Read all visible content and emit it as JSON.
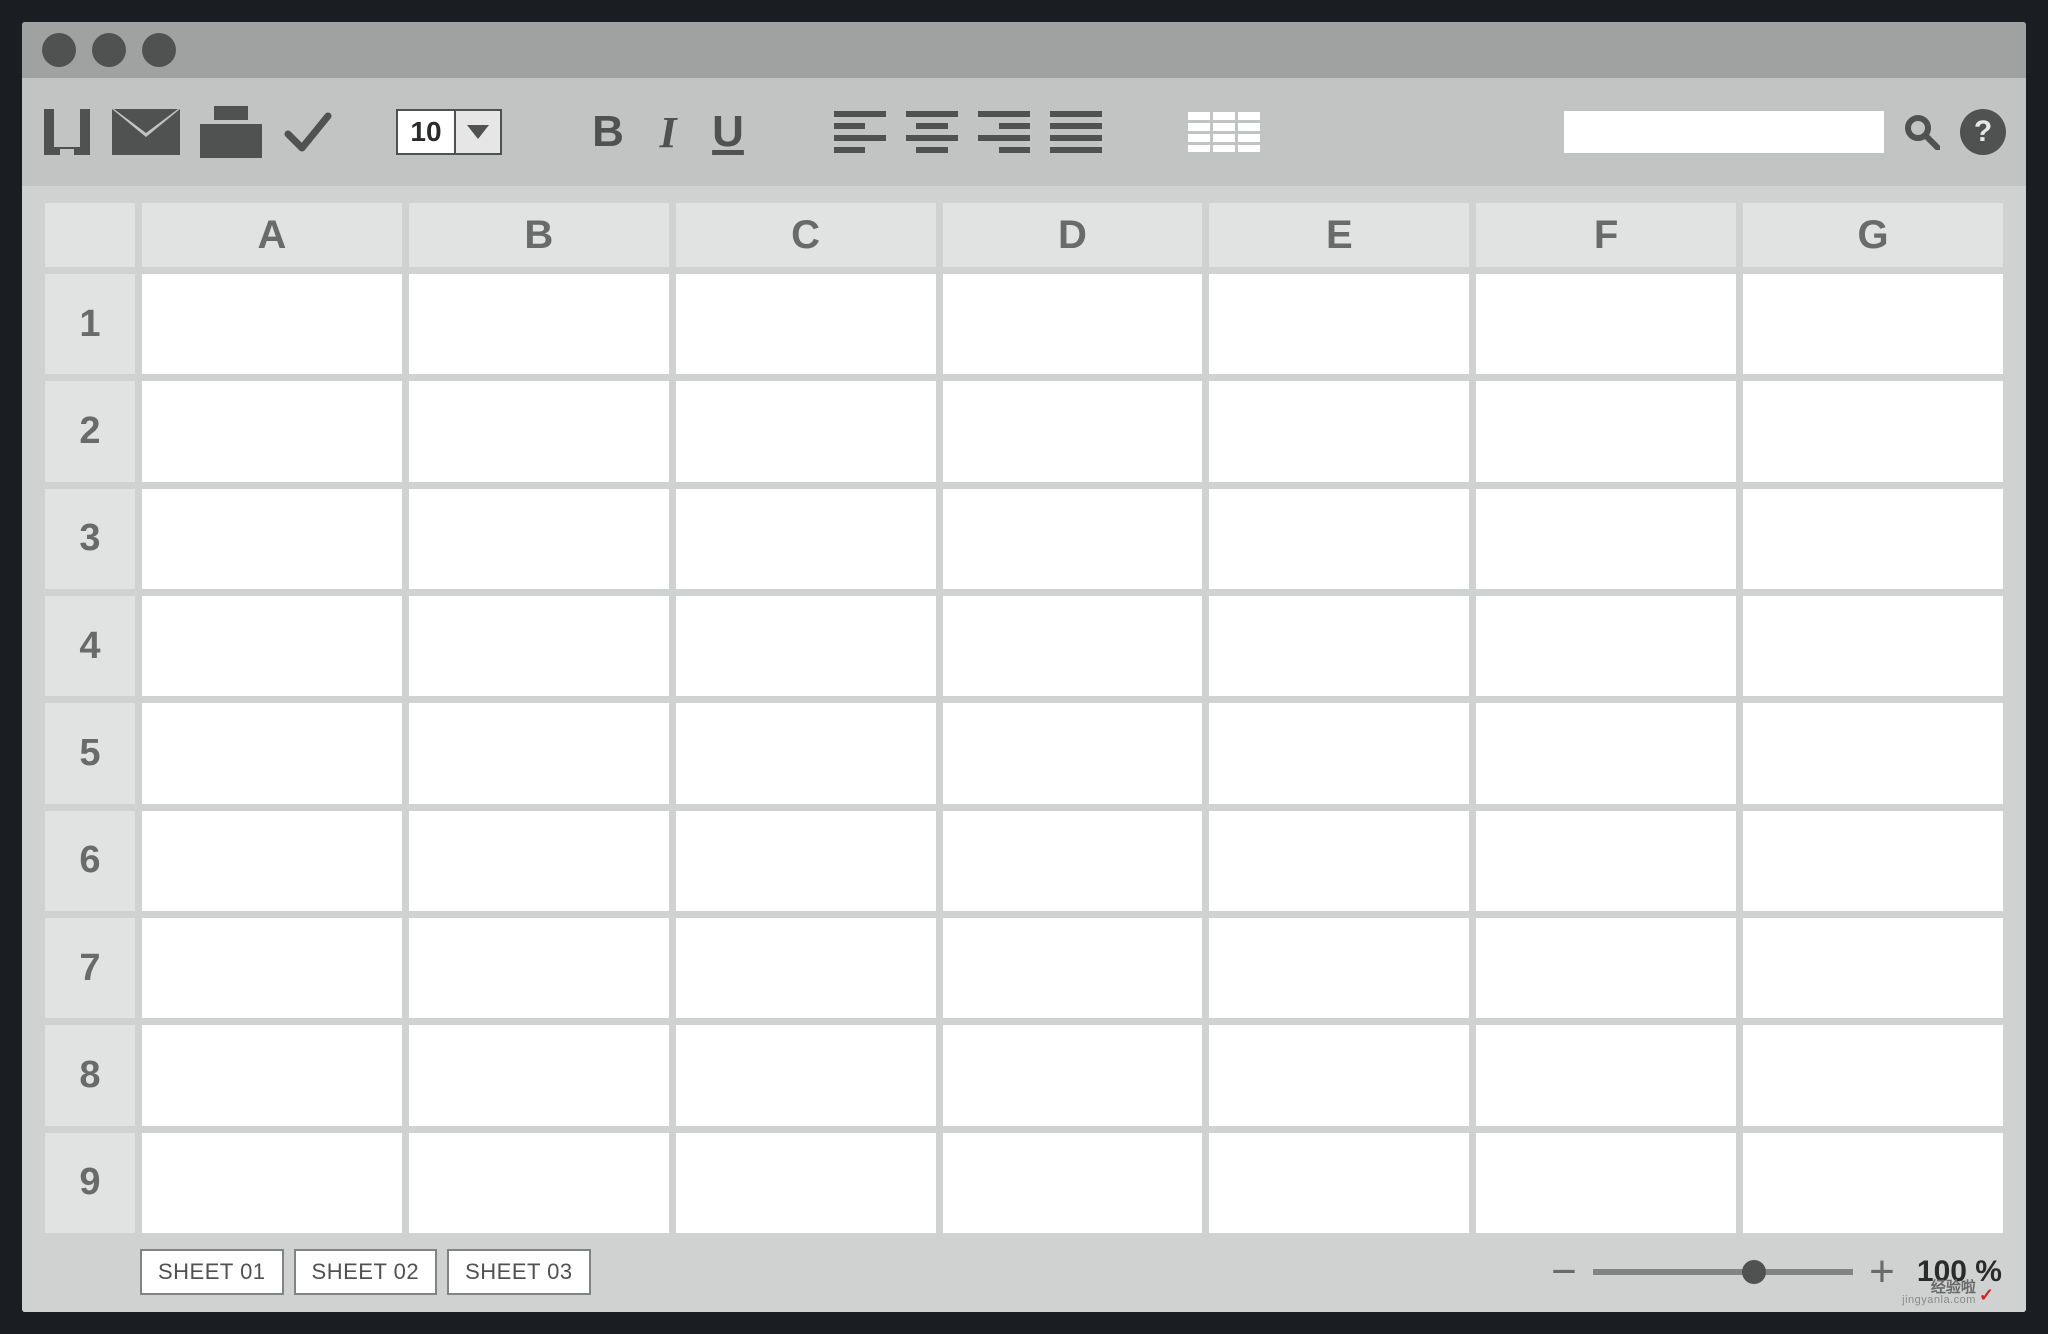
{
  "toolbar": {
    "font_size": "10",
    "bold_label": "B",
    "italic_label": "I",
    "underline_label": "U"
  },
  "columns": [
    "A",
    "B",
    "C",
    "D",
    "E",
    "F",
    "G"
  ],
  "rows": [
    "1",
    "2",
    "3",
    "4",
    "5",
    "6",
    "7",
    "8",
    "9"
  ],
  "sheets": {
    "tab1": "SHEET 01",
    "tab2": "SHEET 02",
    "tab3": "SHEET 03"
  },
  "zoom": {
    "minus": "−",
    "plus": "+",
    "label": "100 %"
  },
  "help": "?",
  "watermark": {
    "brand": "经验啦",
    "site": "jingyanla.com"
  }
}
